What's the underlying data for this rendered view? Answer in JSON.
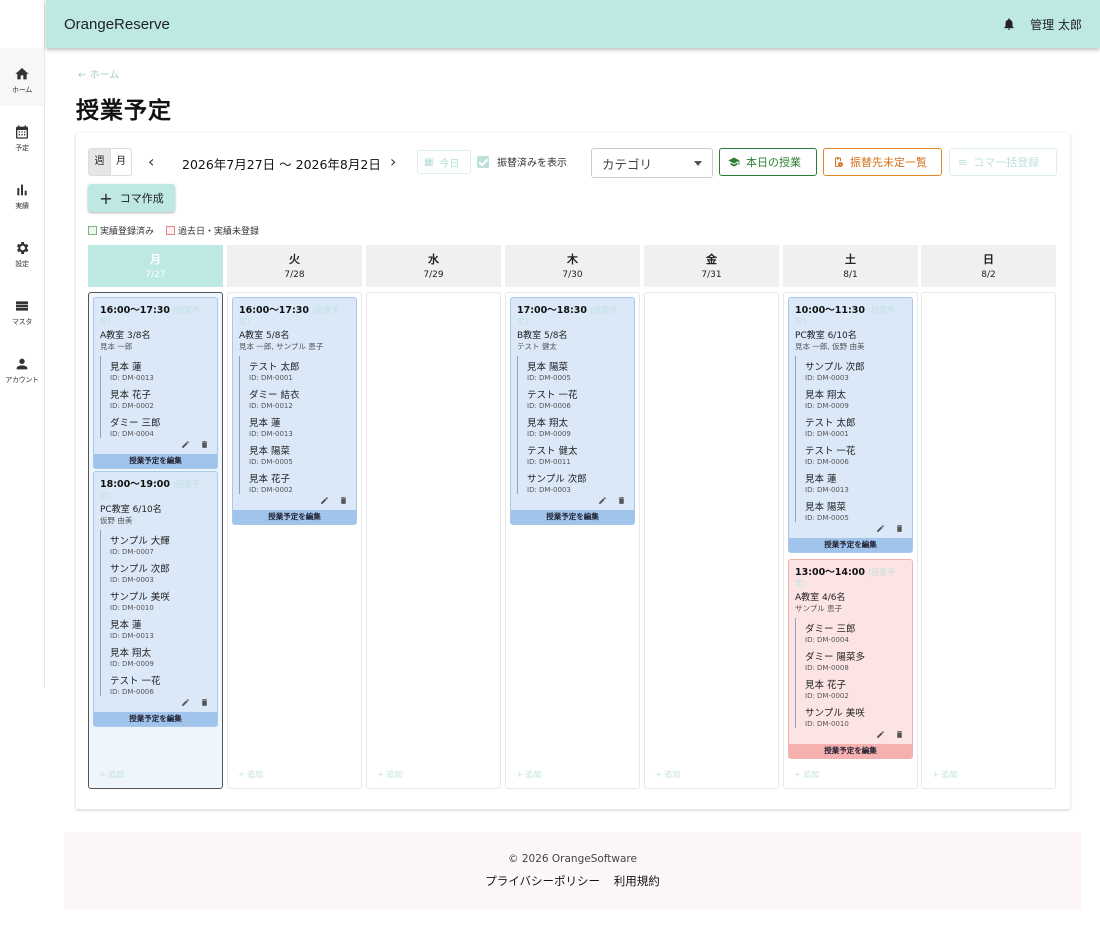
{
  "app": {
    "brand": "OrangeReserve",
    "user": "管理 太郎"
  },
  "sidebar": [
    {
      "icon": "home-icon",
      "label": "ホーム"
    },
    {
      "icon": "calendar-icon",
      "label": "予定"
    },
    {
      "icon": "bar-chart-icon",
      "label": "実績"
    },
    {
      "icon": "gear-icon",
      "label": "設定"
    },
    {
      "icon": "list-icon",
      "label": "マスタ"
    },
    {
      "icon": "person-icon",
      "label": "アカウント"
    }
  ],
  "breadcrumb": "← ホーム",
  "title": "授業予定",
  "toolbar": {
    "week": "週",
    "month": "月",
    "range": "2026年7月27日 〜 2026年8月2日",
    "today": "今日",
    "show_transfers": "振替済みを表示",
    "category": "カテゴリ",
    "today_lessons": "本日の授業",
    "pending_transfers": "振替先未定一覧",
    "bulk_register": "コマ一括登録",
    "create": "コマ作成"
  },
  "legend": {
    "done": "実績登録済み",
    "past": "過去日・実績未登録"
  },
  "add_label": "+ 追加",
  "edit_label": "授業予定を編集",
  "days": [
    {
      "name": "月",
      "date": "7/27",
      "today": true,
      "lessons": [
        {
          "time": "16:00〜17:30",
          "tag": "(授業予定)",
          "room": "A教室 3/8名",
          "teacher": "見本 一郎",
          "style": "blue",
          "students": [
            {
              "name": "見本 蓮",
              "id": "ID: DM-0013"
            },
            {
              "name": "見本 花子",
              "id": "ID: DM-0002"
            },
            {
              "name": "ダミー 三郎",
              "id": "ID: DM-0004"
            }
          ]
        },
        {
          "time": "18:00〜19:00",
          "tag": "(授業予定)",
          "room": "PC教室 6/10名",
          "teacher": "仮野 由美",
          "style": "blue",
          "students": [
            {
              "name": "サンプル 大輝",
              "id": "ID: DM-0007"
            },
            {
              "name": "サンプル 次郎",
              "id": "ID: DM-0003"
            },
            {
              "name": "サンプル 美咲",
              "id": "ID: DM-0010"
            },
            {
              "name": "見本 蓮",
              "id": "ID: DM-0013"
            },
            {
              "name": "見本 翔太",
              "id": "ID: DM-0009"
            },
            {
              "name": "テスト 一花",
              "id": "ID: DM-0006"
            }
          ]
        }
      ]
    },
    {
      "name": "火",
      "date": "7/28",
      "lessons": [
        {
          "time": "16:00〜17:30",
          "tag": "(授業予定)",
          "room": "A教室 5/8名",
          "teacher": "見本 一郎, サンプル 恵子",
          "style": "blue",
          "students": [
            {
              "name": "テスト 太郎",
              "id": "ID: DM-0001"
            },
            {
              "name": "ダミー 結衣",
              "id": "ID: DM-0012"
            },
            {
              "name": "見本 蓮",
              "id": "ID: DM-0013"
            },
            {
              "name": "見本 陽菜",
              "id": "ID: DM-0005"
            },
            {
              "name": "見本 花子",
              "id": "ID: DM-0002"
            }
          ]
        }
      ]
    },
    {
      "name": "水",
      "date": "7/29",
      "lessons": []
    },
    {
      "name": "木",
      "date": "7/30",
      "lessons": [
        {
          "time": "17:00〜18:30",
          "tag": "(授業予定)",
          "room": "B教室 5/8名",
          "teacher": "テスト 健太",
          "style": "blue",
          "students": [
            {
              "name": "見本 陽菜",
              "id": "ID: DM-0005"
            },
            {
              "name": "テスト 一花",
              "id": "ID: DM-0006"
            },
            {
              "name": "見本 翔太",
              "id": "ID: DM-0009"
            },
            {
              "name": "テスト 健太",
              "id": "ID: DM-0011"
            },
            {
              "name": "サンプル 次郎",
              "id": "ID: DM-0003"
            }
          ]
        }
      ]
    },
    {
      "name": "金",
      "date": "7/31",
      "lessons": []
    },
    {
      "name": "土",
      "date": "8/1",
      "lessons": [
        {
          "time": "10:00〜11:30",
          "tag": "(授業予定)",
          "room": "PC教室 6/10名",
          "teacher": "見本 一郎, 仮野 由美",
          "style": "blue",
          "students": [
            {
              "name": "サンプル 次郎",
              "id": "ID: DM-0003"
            },
            {
              "name": "見本 翔太",
              "id": "ID: DM-0009"
            },
            {
              "name": "テスト 太郎",
              "id": "ID: DM-0001"
            },
            {
              "name": "テスト 一花",
              "id": "ID: DM-0006"
            },
            {
              "name": "見本 蓮",
              "id": "ID: DM-0013"
            },
            {
              "name": "見本 陽菜",
              "id": "ID: DM-0005"
            }
          ]
        },
        {
          "time": "13:00〜14:00",
          "tag": "(授業予定)",
          "room": "A教室 4/6名",
          "teacher": "サンプル 恵子",
          "style": "pink",
          "students": [
            {
              "name": "ダミー 三郎",
              "id": "ID: DM-0004"
            },
            {
              "name": "ダミー 陽菜多",
              "id": "ID: DM-0008"
            },
            {
              "name": "見本 花子",
              "id": "ID: DM-0002"
            },
            {
              "name": "サンプル 美咲",
              "id": "ID: DM-0010"
            }
          ]
        }
      ]
    },
    {
      "name": "日",
      "date": "8/2",
      "lessons": []
    }
  ],
  "footer": {
    "copyright": "© 2026 OrangeSoftware",
    "privacy": "プライバシーポリシー",
    "terms": "利用規約"
  }
}
